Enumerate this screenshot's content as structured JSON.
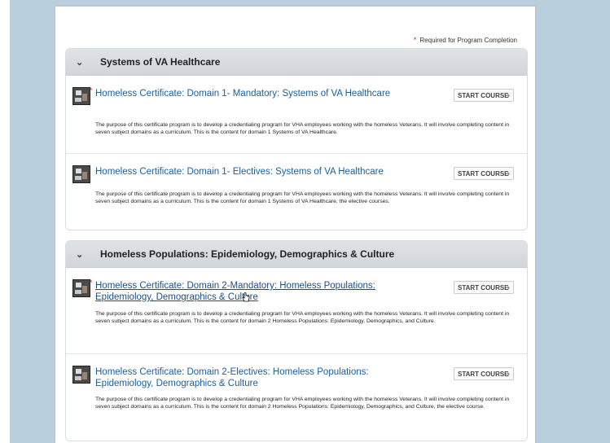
{
  "required_note": {
    "star": "*",
    "text": "Required for Program Completion"
  },
  "sections": [
    {
      "title": "Systems of VA Healthcare",
      "courses": [
        {
          "title": "Homeless Certificate: Domain 1- Mandatory: Systems of VA Healthcare",
          "required": true,
          "button": "START COURSE",
          "description": "The purpose of this certificate program is to develop a credentialing program for VHA employees working with the homeless Veterans. It will involve completing content in seven subject domains as a curriculum. This is the content for domain 1 Systems of VA Healthcare."
        },
        {
          "title": "Homeless Certificate: Domain 1- Electives: Systems of VA Healthcare",
          "required": false,
          "button": "START COURSE",
          "description": "The purpose of this certificate program is to develop a credentialing program for VHA employees working with the homeless Veterans. It will involve completing content in seven subject domains as a curriculum. This is the content for domain 1 Systems of VA Healthcare, the elective courses."
        }
      ]
    },
    {
      "title": "Homeless Populations: Epidemiology, Demographics & Culture",
      "courses": [
        {
          "title": "Homeless Certificate: Domain 2-Mandatory: Homeless Populations: Epidemiology, Demographics & Culture",
          "required": true,
          "button": "START COURSE",
          "description": "The purpose of this certificate program is to develop a credentialing program for VHA employees working with the homeless Veterans. It will involve completing content in seven subject domains as a curriculum. This is the content for domain 2 Homeless Populations: Epidemiology, Demographics, and Culture."
        },
        {
          "title": "Homeless Certificate: Domain 2-Electives: Homeless Populations: Epidemiology, Demographics & Culture",
          "required": false,
          "button": "START COURSE",
          "description": "The purpose of this certificate program is to develop a credentialing program for VHA employees working with the homeless Veterans. It will involve completing content in seven subject domains as a curriculum. This is the content for domain 2 Homeless Populations: Epidemiology, Demographics, and Culture, the elective course."
        }
      ]
    }
  ],
  "chevron_icon": "chevron-down-icon",
  "course_icon": "course-thumbnail-icon",
  "colors": {
    "link": "#1a5fa0",
    "required": "#b8282e",
    "header_bg": "#d8dbe0",
    "background": "#b9cfdc"
  }
}
